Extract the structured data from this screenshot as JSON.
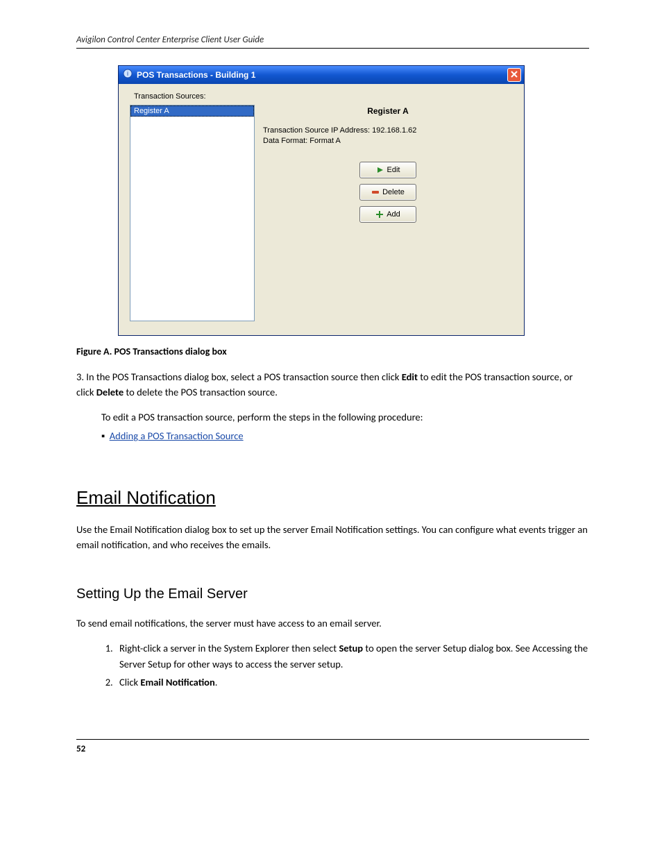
{
  "header": {
    "running_title": "Avigilon Control Center Enterprise Client User Guide"
  },
  "window": {
    "title": "POS Transactions - Building 1",
    "sources_label": "Transaction Sources:",
    "list": {
      "items": [
        "Register A"
      ]
    },
    "detail": {
      "title": "Register A",
      "ip_label": "Transaction Source IP Address:",
      "ip_value": "192.168.1.62",
      "format_label": "Data Format:",
      "format_value": "Format A"
    },
    "buttons": {
      "edit": "Edit",
      "delete": "Delete",
      "add": "Add"
    }
  },
  "figure_caption": "Figure A.    POS Transactions dialog box",
  "paragraphs": {
    "p1_a": "3. In the POS Transactions dialog box, select a POS transaction source then click ",
    "p1_edit": "Edit",
    "p1_b": " to edit the POS transaction source, or click ",
    "p1_delete": "Delete",
    "p1_c": " to delete the POS transaction source.",
    "indent_intro": "To edit a POS transaction source, perform the steps in the following procedure:",
    "indent_link": "Adding a POS Transaction Source"
  },
  "h1": "Email Notification",
  "section_text": "Use the Email Notification dialog box to set up the server Email Notification settings. You can configure what events trigger an email notification, and who receives the emails.",
  "h2": "Setting Up the Email Server",
  "email_intro": "To send email notifications, the server must have access to an email server.",
  "steps": {
    "s1_a": "Right-click a server in the System Explorer then select ",
    "s1_b": "Setup",
    "s1_c": " to open the server Setup dialog box. ",
    "s1_link": "See Accessing the Server Setup",
    "s1_d": " for other ways to access the server setup.",
    "s2_a": "Click ",
    "s2_b": "Email Notification",
    "s2_c": "."
  },
  "footer": {
    "page_number": "52"
  }
}
